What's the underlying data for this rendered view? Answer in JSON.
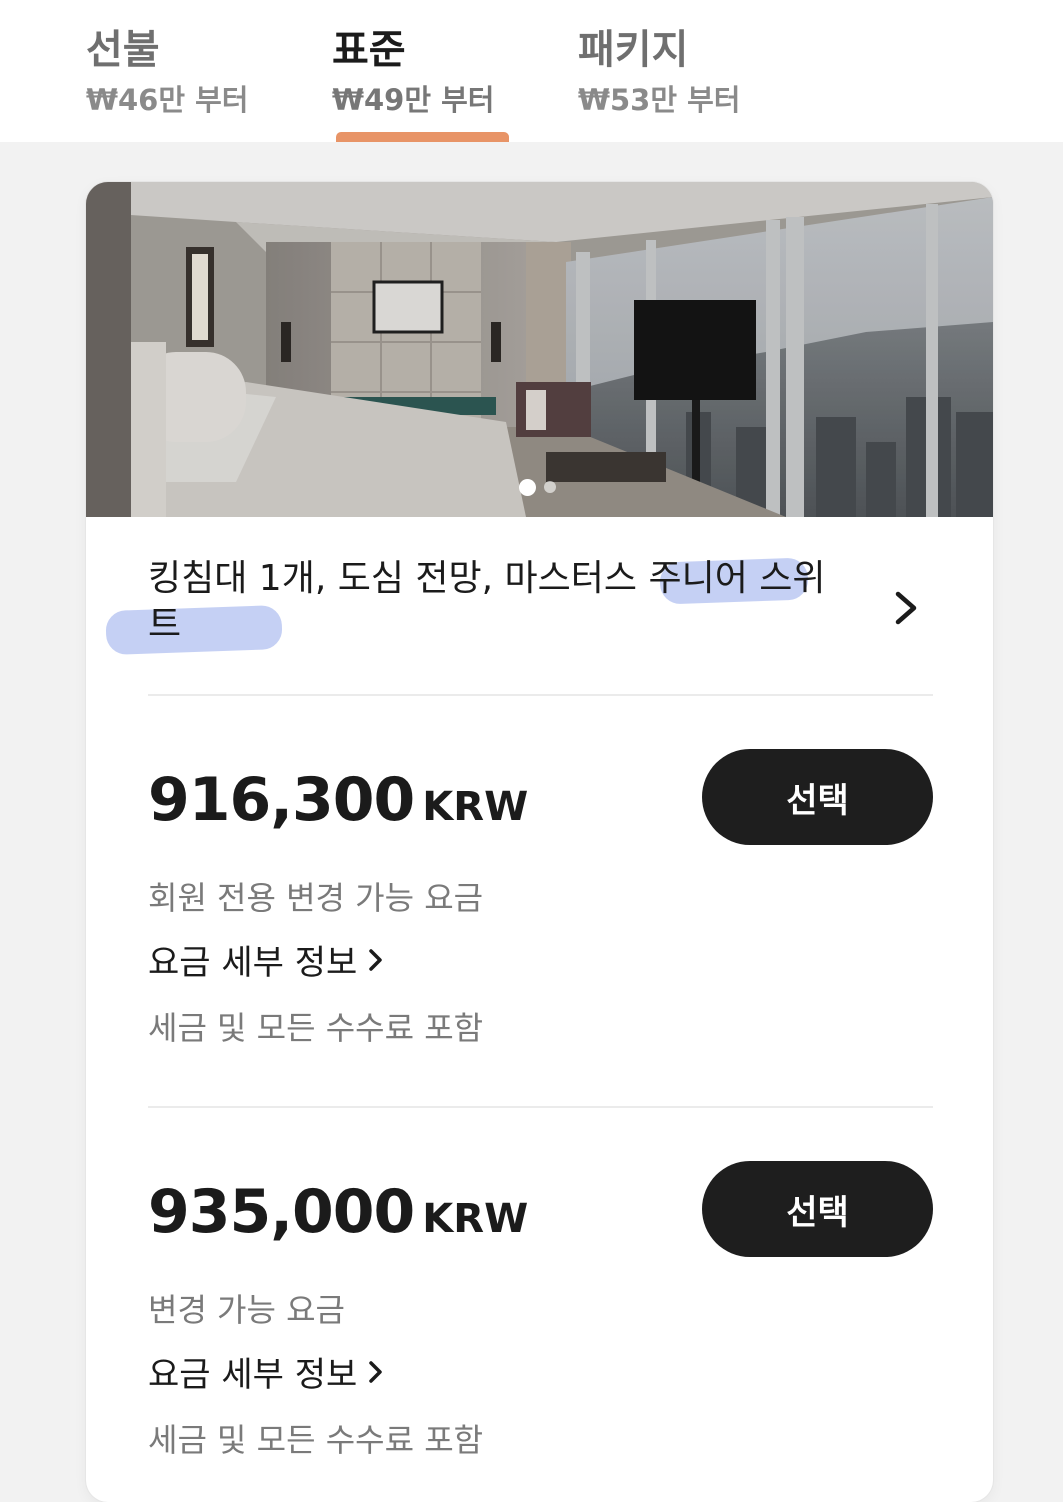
{
  "tabs": [
    {
      "name": "선불",
      "price": "₩46만 부터",
      "active": false
    },
    {
      "name": "표준",
      "price": "₩49만 부터",
      "active": true
    },
    {
      "name": "패키지",
      "price": "₩53만 부터",
      "active": false
    }
  ],
  "accent_color": "#e89467",
  "room": {
    "title": "킹침대 1개, 도심 전망, 마스터스 주니어 스위트",
    "photo_icon": "hotel-room-photo",
    "carousel": {
      "current": 1,
      "total": 2
    }
  },
  "rates": [
    {
      "amount": "916,300",
      "currency": "KRW",
      "select_label": "선택",
      "type": "회원 전용 변경 가능 요금",
      "details_label": "요금 세부 정보",
      "tax_note": "세금 및 모든 수수료 포함"
    },
    {
      "amount": "935,000",
      "currency": "KRW",
      "select_label": "선택",
      "type": "변경 가능 요금",
      "details_label": "요금 세부 정보",
      "tax_note": "세금 및 모든 수수료 포함"
    }
  ]
}
